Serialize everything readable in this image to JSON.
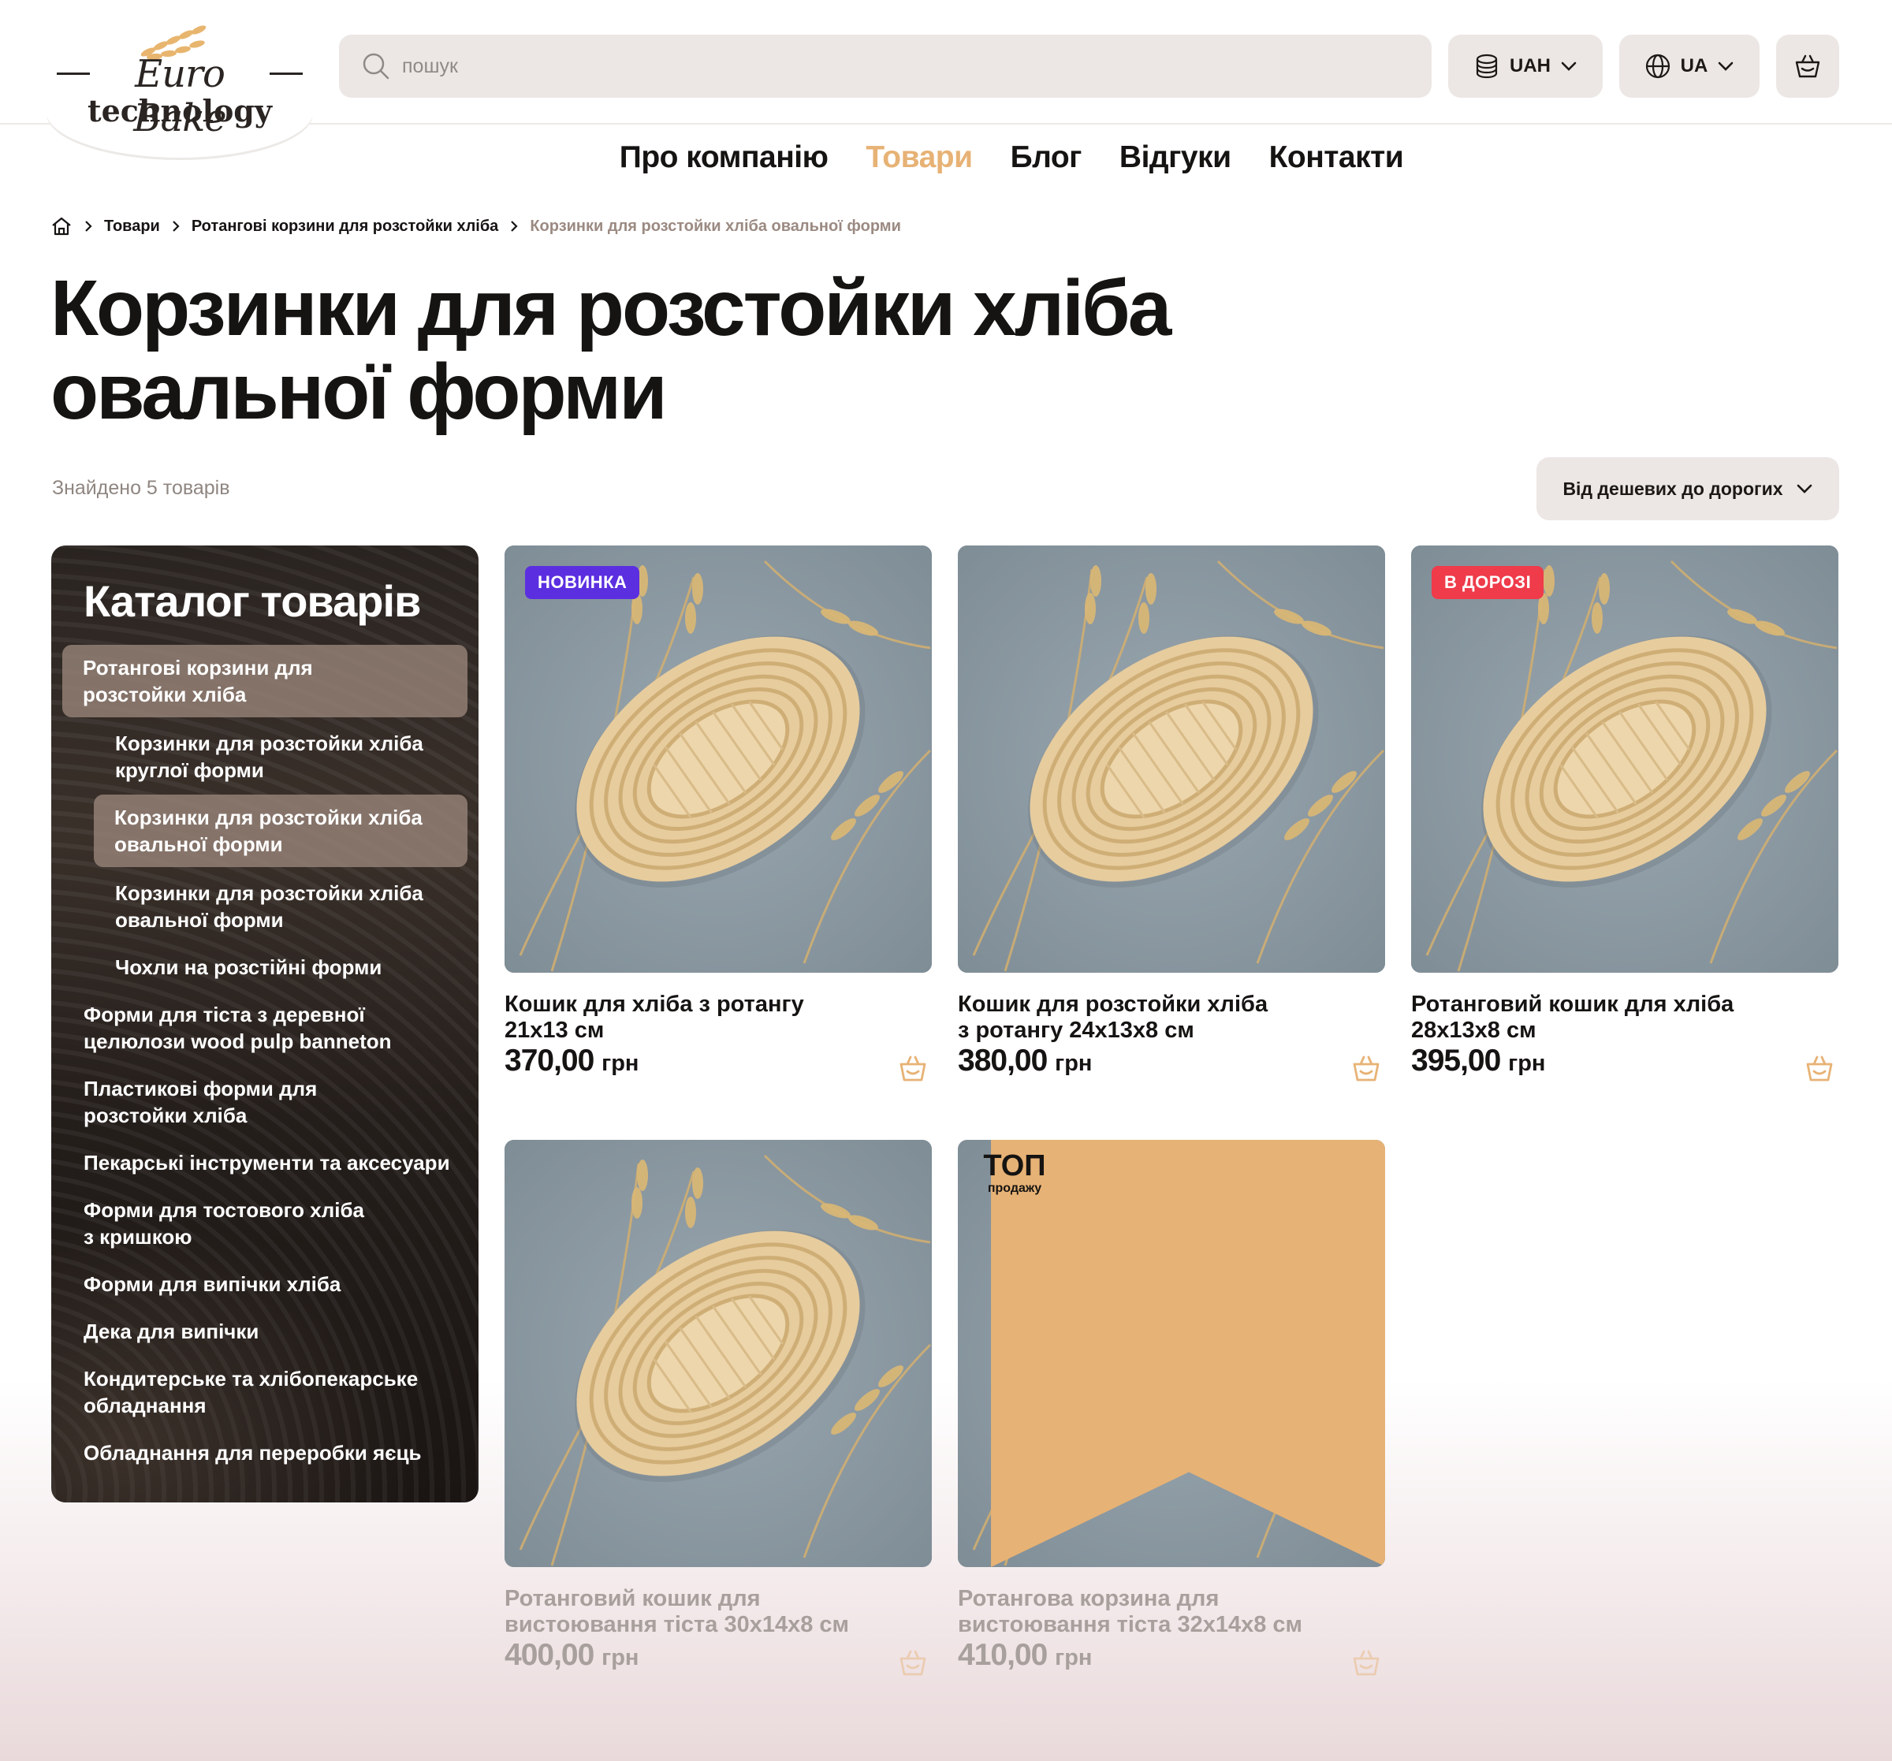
{
  "header": {
    "logo_title": "Euro Bake",
    "logo_sub": "technology",
    "search_placeholder": "пошук",
    "currency": "UAH",
    "language": "UA"
  },
  "nav": [
    {
      "label": "Про компанію",
      "active": false
    },
    {
      "label": "Товари",
      "active": true
    },
    {
      "label": "Блог",
      "active": false
    },
    {
      "label": "Відгуки",
      "active": false
    },
    {
      "label": "Контакти",
      "active": false
    }
  ],
  "breadcrumb": [
    "Товари",
    "Ротангові корзини для розстойки хліба",
    "Корзинки для розстойки хліба овальної форми"
  ],
  "page": {
    "title_line1": "Корзинки для розстойки хліба",
    "title_line2": "овальної форми",
    "found": "Знайдено 5 товарів",
    "sort": "Від дешевих до дорогих"
  },
  "sidebar": {
    "title": "Каталог товарів",
    "items": [
      {
        "label_l1": "Ротангові корзини для",
        "label_l2": "розстойки хліба"
      },
      {
        "label_l1": "Корзинки для розстойки хліба",
        "label_l2": "круглої форми"
      },
      {
        "label_l1": "Корзинки для розстойки хліба",
        "label_l2": "овальної форми"
      },
      {
        "label_l1": "Корзинки для розстойки хліба",
        "label_l2": "овальної форми"
      },
      {
        "label_l1": "Чохли на розстійні форми",
        "label_l2": ""
      },
      {
        "label_l1": "Форми для тіста з деревної",
        "label_l2": "целюлози wood pulp banneton"
      },
      {
        "label_l1": "Пластикові форми для",
        "label_l2": "розстойки хліба"
      },
      {
        "label_l1": "Пекарські інструменти та аксесуари",
        "label_l2": ""
      },
      {
        "label_l1": "Форми для тостового хліба",
        "label_l2": "з кришкою"
      },
      {
        "label_l1": "Форми для випічки хліба",
        "label_l2": ""
      },
      {
        "label_l1": "Дека для випічки",
        "label_l2": ""
      },
      {
        "label_l1": "Кондитерське та хлібопекарське",
        "label_l2": "обладнання"
      },
      {
        "label_l1": "Обладнання для переробки яєць",
        "label_l2": ""
      }
    ]
  },
  "products": [
    {
      "name_l1": "Кошик для хліба з ротангу",
      "name_l2": "21х13 см",
      "price": "370,00",
      "currency": "грн",
      "badge": "НОВИНКА"
    },
    {
      "name_l1": "Кошик для розстойки хліба",
      "name_l2": "з ротангу 24х13х8 см",
      "price": "380,00",
      "currency": "грн",
      "badge": ""
    },
    {
      "name_l1": "Ротанговий кошик для хліба",
      "name_l2": "28х13х8 см",
      "price": "395,00",
      "currency": "грн",
      "badge": "В ДОРОЗІ"
    },
    {
      "name_l1": "Ротанговий кошик для",
      "name_l2": "вистоювання тіста 30х14х8 см",
      "price": "400,00",
      "currency": "грн",
      "badge": ""
    },
    {
      "name_l1": "Ротангова корзина для",
      "name_l2": "вистоювання тіста 32х14х8 см",
      "price": "410,00",
      "currency": "грн",
      "badge_top": "ТОП",
      "badge_top_sub": "продажу"
    }
  ],
  "colors": {
    "accent": "#e7b275",
    "badge_new": "#5b2fe0",
    "badge_road": "#ef3b4a",
    "pill_bg": "#ece7e5"
  }
}
